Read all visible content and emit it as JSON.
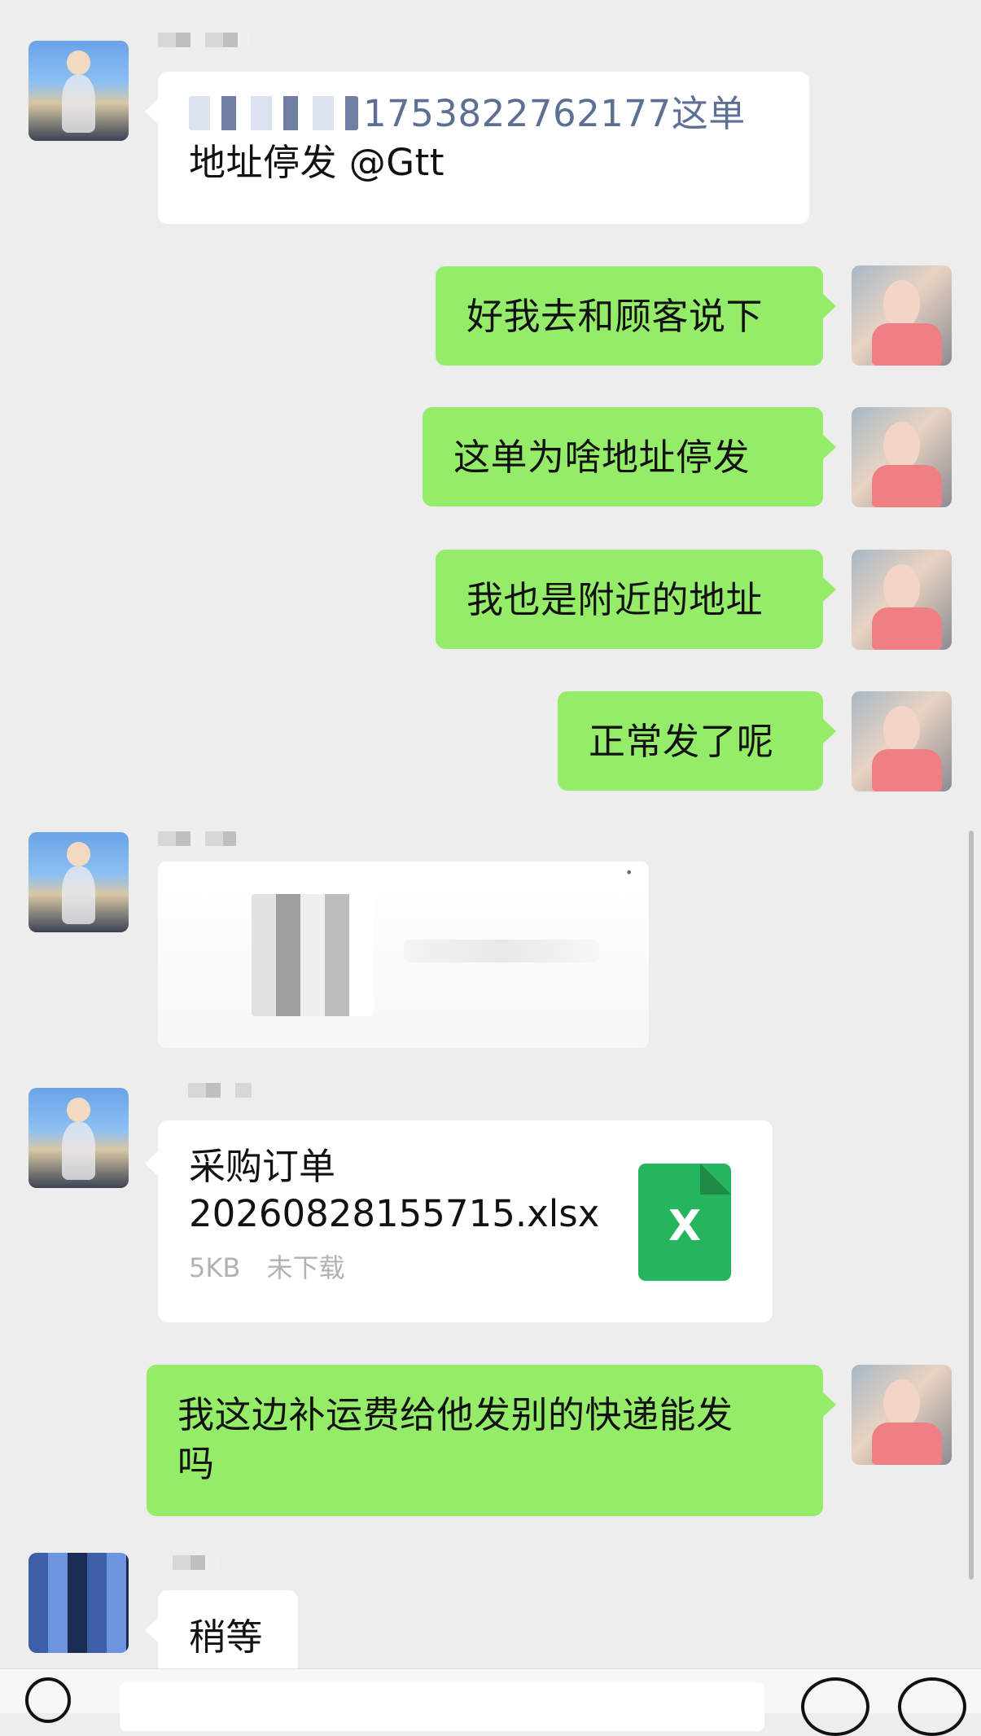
{
  "conversation": {
    "messages": [
      {
        "side": "left",
        "sender_tag": "",
        "text_visible": "1753822762177这单",
        "line2": "地址停发 @Gtt"
      },
      {
        "side": "right",
        "text": "好我去和顾客说下"
      },
      {
        "side": "right",
        "text": "这单为啥地址停发"
      },
      {
        "side": "right",
        "text": "我也是附近的地址"
      },
      {
        "side": "right",
        "text": "正常发了呢"
      },
      {
        "side": "left",
        "type": "image"
      },
      {
        "side": "left",
        "type": "file",
        "title_line1": "采购订单",
        "title_line2": "20260828155715.xlsx",
        "size": "5KB",
        "status": "未下载",
        "icon": "spreadsheet-icon"
      },
      {
        "side": "right",
        "text_line1": "我这边补运费给他发别的快递能发",
        "text_line2": "吗"
      },
      {
        "side": "left",
        "text": "稍等"
      }
    ]
  },
  "colors": {
    "background": "#ededed",
    "incoming": "#ffffff",
    "outgoing": "#95ec69",
    "file_icon": "#25b55f"
  },
  "icons": {
    "voice": "microphone-icon",
    "emoji": "emoji-icon",
    "add": "plus-icon"
  }
}
